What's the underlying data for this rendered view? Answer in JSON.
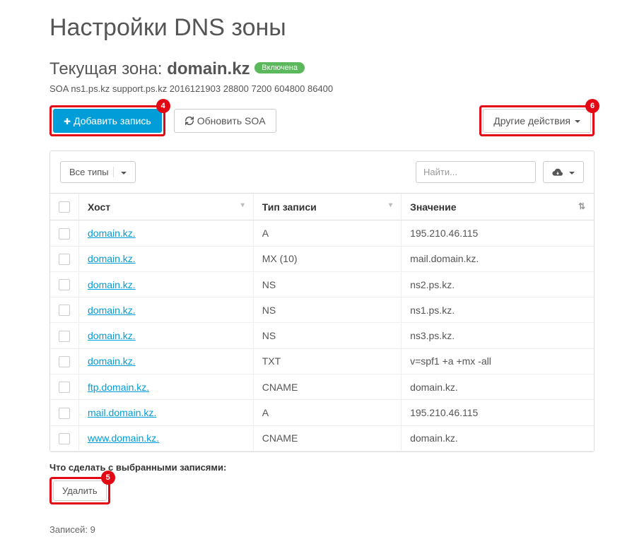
{
  "page_title": "Настройки DNS зоны",
  "zone": {
    "prefix": "Текущая зона: ",
    "domain": "domain.kz",
    "status_label": "Включена",
    "soa_line": "SOA ns1.ps.kz support.ps.kz 2016121903 28800 7200 604800 86400"
  },
  "buttons": {
    "add_record": "Добавить запись",
    "refresh_soa": "Обновить SOA",
    "other_actions": "Другие действия"
  },
  "annotations": {
    "add": "4",
    "delete": "5",
    "other": "6"
  },
  "filter": {
    "all_types": "Все типы",
    "search_placeholder": "Найти..."
  },
  "columns": {
    "host": "Хост",
    "type": "Тип записи",
    "value": "Значение"
  },
  "rows": [
    {
      "host": "domain.kz.",
      "type": "A",
      "value": "195.210.46.115"
    },
    {
      "host": "domain.kz.",
      "type": "MX (10)",
      "value": "mail.domain.kz."
    },
    {
      "host": "domain.kz.",
      "type": "NS",
      "value": "ns2.ps.kz."
    },
    {
      "host": "domain.kz.",
      "type": "NS",
      "value": "ns1.ps.kz."
    },
    {
      "host": "domain.kz.",
      "type": "NS",
      "value": "ns3.ps.kz."
    },
    {
      "host": "domain.kz.",
      "type": "TXT",
      "value": "v=spf1 +a +mx -all"
    },
    {
      "host": "ftp.domain.kz.",
      "type": "CNAME",
      "value": "domain.kz."
    },
    {
      "host": "mail.domain.kz.",
      "type": "A",
      "value": "195.210.46.115"
    },
    {
      "host": "www.domain.kz.",
      "type": "CNAME",
      "value": "domain.kz."
    }
  ],
  "bulk": {
    "label": "Что сделать с выбранными записями:",
    "delete": "Удалить"
  },
  "footer": {
    "records_prefix": "Записей: ",
    "count": "9"
  }
}
